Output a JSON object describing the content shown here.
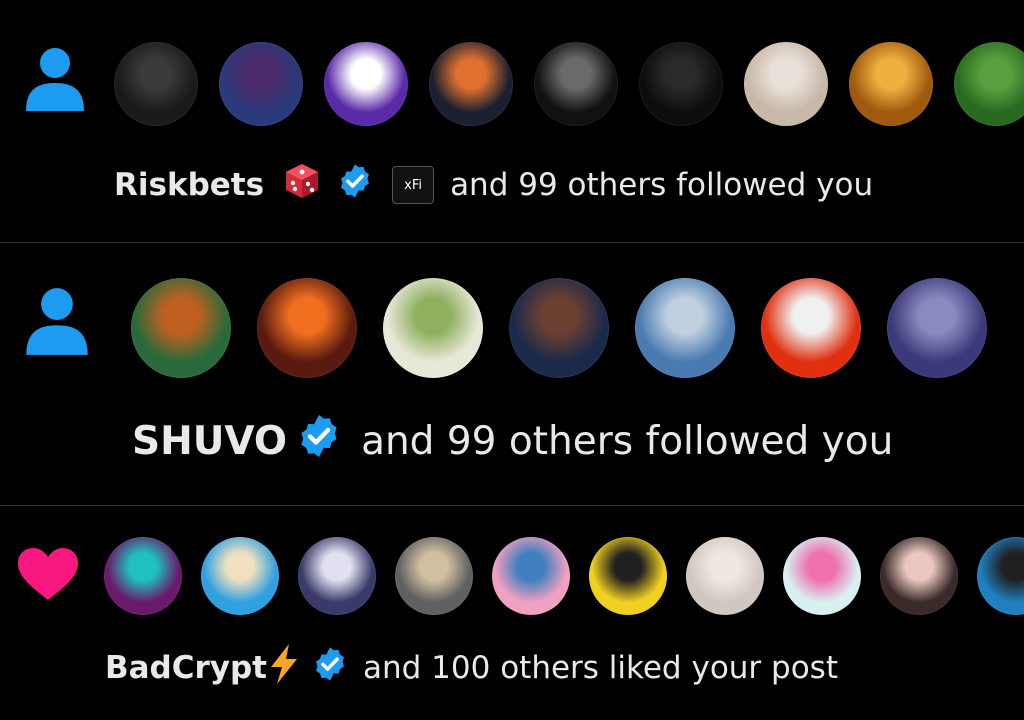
{
  "colors": {
    "background": "#000000",
    "text": "#e7e9ea",
    "follow_icon": "#1d9bf0",
    "like_icon": "#f91880",
    "verified": "#1d9bf0"
  },
  "notifications": [
    {
      "type": "follow",
      "icon": "person-icon",
      "name": "Riskbets",
      "badges": [
        "dice-emoji",
        "verified-badge-icon",
        "xfi-badge"
      ],
      "xfi_label": "xFi",
      "text": "and 99 others followed you",
      "avatar_colors": [
        [
          "#1a1a1a",
          "#3a3a3a"
        ],
        [
          "#2a3a7a",
          "#4a2a6a"
        ],
        [
          "#5a2aa8",
          "#ffffff"
        ],
        [
          "#1a2030",
          "#e07030"
        ],
        [
          "#111111",
          "#6a6a6a"
        ],
        [
          "#0d0d0d",
          "#2a2a2a"
        ],
        [
          "#c8b8a8",
          "#e8e0d8"
        ],
        [
          "#a05a10",
          "#f0b040"
        ],
        [
          "#2a6a20",
          "#5aa040"
        ]
      ]
    },
    {
      "type": "follow",
      "icon": "person-icon",
      "name": "SHUVO",
      "badges": [
        "verified-badge-icon"
      ],
      "text": "and 99 others followed you",
      "avatar_colors": [
        [
          "#2a6a3a",
          "#c06020"
        ],
        [
          "#5a1a10",
          "#f07020"
        ],
        [
          "#e8e8d8",
          "#90b060"
        ],
        [
          "#1a2a4a",
          "#6a4030"
        ],
        [
          "#4a7ab0",
          "#c0d0e0"
        ],
        [
          "#e03010",
          "#f0f0f0"
        ],
        [
          "#3a3a7a",
          "#8a8ac0"
        ]
      ]
    },
    {
      "type": "like",
      "icon": "heart-icon",
      "name": "BadCrypt",
      "badges": [
        "lightning-emoji",
        "verified-badge-icon"
      ],
      "text": "and 100 others liked your post",
      "avatar_colors": [
        [
          "#6a1a6a",
          "#20c0c0"
        ],
        [
          "#30a0e0",
          "#f0e0c0"
        ],
        [
          "#3a3a6a",
          "#e0e0f0"
        ],
        [
          "#606060",
          "#d0c0a0"
        ],
        [
          "#f0a0c0",
          "#4080c0"
        ],
        [
          "#f0d020",
          "#202020"
        ],
        [
          "#d0c8c0",
          "#f0e8e0"
        ],
        [
          "#d8f0f0",
          "#f070b0"
        ],
        [
          "#3a2a2a",
          "#e8c8c0"
        ],
        [
          "#2080c0",
          "#202020"
        ]
      ]
    }
  ]
}
